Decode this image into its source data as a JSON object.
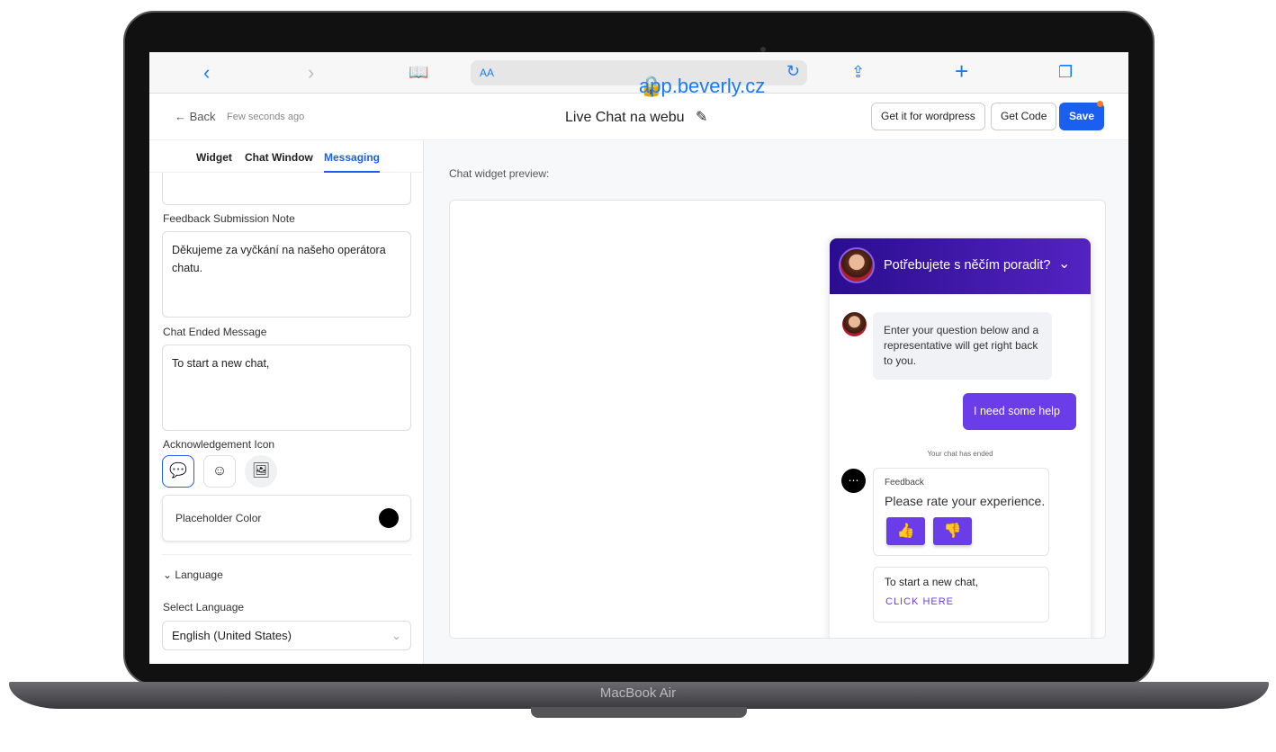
{
  "device": {
    "brand": "MacBook Air"
  },
  "browser": {
    "url": "app.beverly.cz",
    "text_size": "AA"
  },
  "header": {
    "back": "Back",
    "saved": "Few seconds ago",
    "title": "Live Chat na webu",
    "wordpress": "Get it for wordpress",
    "get_code": "Get Code",
    "save": "Save"
  },
  "tabs": [
    {
      "label": "Widget"
    },
    {
      "label": "Chat Window"
    },
    {
      "label": "Messaging",
      "active": true
    }
  ],
  "form": {
    "feedback_note_label": "Feedback Submission Note",
    "feedback_note": "Děkujeme za vyčkání na našeho operátora chatu.",
    "ended_label": "Chat Ended Message",
    "ended": "To start a new chat,",
    "ack_label": "Acknowledgement Icon",
    "ack_icons": [
      "chat-dots-icon",
      "chat-smile-icon",
      "image-add-icon"
    ],
    "placeholder_color_label": "Placeholder Color",
    "placeholder_color": "#000000",
    "language_section": "Language",
    "select_language_label": "Select Language",
    "language": "English (United States)"
  },
  "preview": {
    "label": "Chat widget preview:",
    "header": "Potřebujete s něčím poradit?",
    "bot_message": "Enter your question below and a representative will get right back to you.",
    "user_message": "I need some help",
    "ended": "Your chat has ended",
    "feedback_title": "Feedback",
    "feedback_prompt": "Please rate your experience.",
    "end_message": "To start a new chat,",
    "click_here": "CLICK HERE",
    "accent": "#6a3de8"
  }
}
